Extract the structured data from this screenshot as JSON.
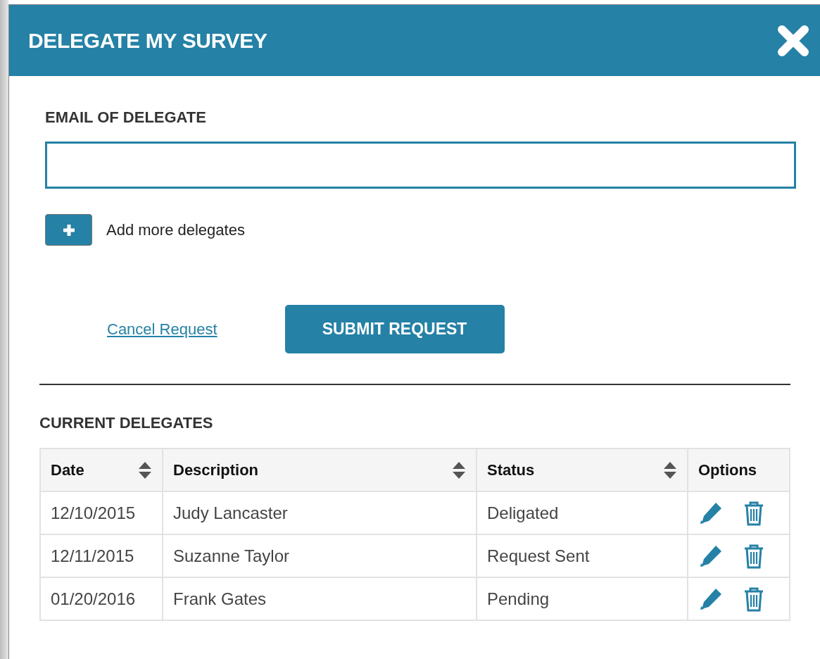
{
  "dialog": {
    "title": "DELEGATE MY SURVEY"
  },
  "email_field": {
    "label": "EMAIL OF DELEGATE"
  },
  "add_more": {
    "label": "Add more delegates"
  },
  "actions": {
    "cancel": "Cancel Request",
    "submit": "SUBMIT REQUEST"
  },
  "current_delegates": {
    "title": "CURRENT DELEGATES",
    "columns": [
      {
        "label": "Date",
        "sortable": true
      },
      {
        "label": "Description",
        "sortable": true
      },
      {
        "label": "Status",
        "sortable": true
      },
      {
        "label": "Options",
        "sortable": false
      }
    ],
    "rows": [
      {
        "date": "12/10/2015",
        "description": "Judy Lancaster",
        "status": "Deligated"
      },
      {
        "date": "12/11/2015",
        "description": "Suzanne Taylor",
        "status": "Request Sent"
      },
      {
        "date": "01/20/2016",
        "description": "Frank Gates",
        "status": "Pending"
      }
    ]
  }
}
